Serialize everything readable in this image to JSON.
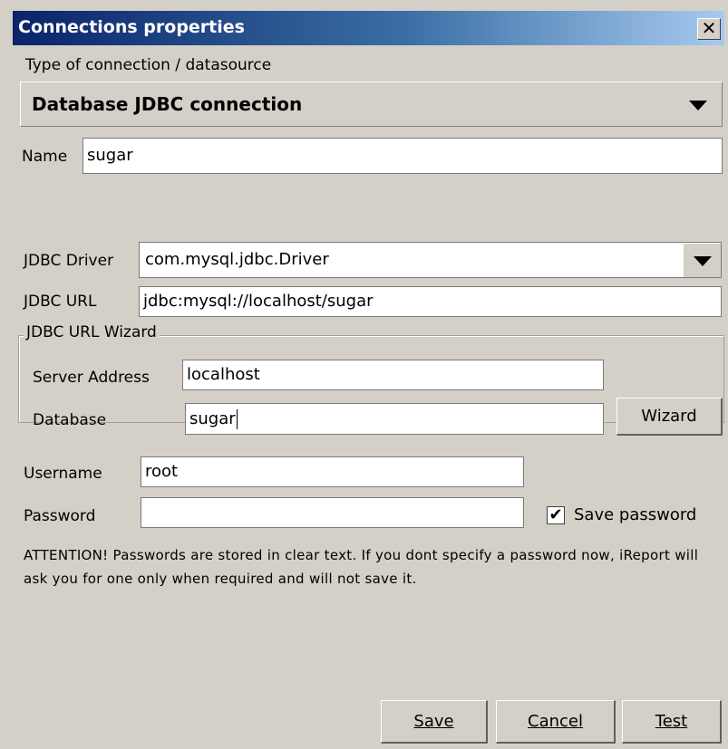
{
  "window": {
    "title": "Connections properties",
    "close_glyph": "✕"
  },
  "connection_type": {
    "label": "Type of connection / datasource",
    "selected": "Database JDBC connection"
  },
  "name": {
    "label": "Name",
    "value": "sugar"
  },
  "jdbc_driver": {
    "label": "JDBC Driver",
    "selected": "com.mysql.jdbc.Driver"
  },
  "jdbc_url": {
    "label": "JDBC URL",
    "value": "jdbc:mysql://localhost/sugar"
  },
  "wizard_group": {
    "title": "JDBC URL Wizard",
    "server_address_label": "Server Address",
    "server_address_value": "localhost",
    "database_label": "Database",
    "database_value": "sugar",
    "wizard_button": "Wizard"
  },
  "username": {
    "label": "Username",
    "value": "root"
  },
  "password": {
    "label": "Password",
    "value": ""
  },
  "save_password": {
    "label": "Save password",
    "checked": true,
    "check_glyph": "✔"
  },
  "attention_text": "ATTENTION! Passwords are stored in clear text. If you dont specify a password now, iReport will ask you for one only when required and will not save it.",
  "buttons": {
    "save": "Save",
    "cancel": "Cancel",
    "test": "Test"
  }
}
